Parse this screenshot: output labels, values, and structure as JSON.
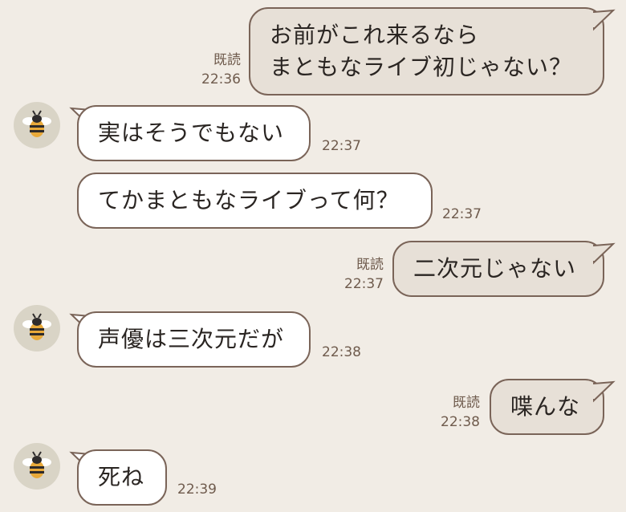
{
  "messages": [
    {
      "side": "out",
      "lines": [
        "お前がこれ来るなら",
        "まともなライブ初じゃない？"
      ],
      "read": "既読",
      "time": "22:36"
    },
    {
      "side": "in",
      "lines": [
        "実はそうでもない"
      ],
      "time": "22:37",
      "avatar_icon": "bee-icon"
    },
    {
      "side": "in",
      "lines": [
        "てかまともなライブって何？"
      ],
      "time": "22:37"
    },
    {
      "side": "out",
      "lines": [
        "二次元じゃない"
      ],
      "read": "既読",
      "time": "22:37"
    },
    {
      "side": "in",
      "lines": [
        "声優は三次元だが"
      ],
      "time": "22:38",
      "avatar_icon": "bee-icon"
    },
    {
      "side": "out",
      "lines": [
        "喋んな"
      ],
      "read": "既読",
      "time": "22:38"
    },
    {
      "side": "in",
      "lines": [
        "死ね"
      ],
      "time": "22:39",
      "avatar_icon": "bee-icon"
    }
  ],
  "colors": {
    "background": "#f1ece5",
    "incoming_bubble": "#ffffff",
    "outgoing_bubble": "#e7e0d7",
    "bubble_border": "#7a6458",
    "meta_text": "#6f5b4d"
  }
}
